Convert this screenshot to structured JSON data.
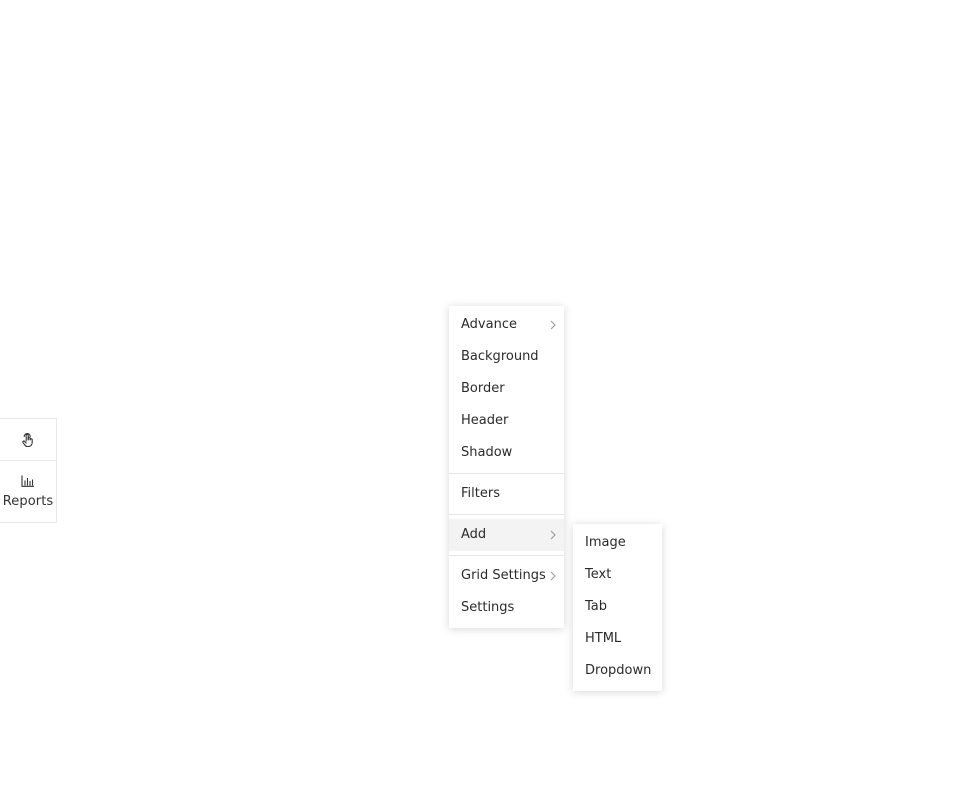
{
  "toolbar": {
    "interact_icon": "hand-pointer-icon",
    "reports_icon": "bar-chart-icon",
    "reports_label": "Reports"
  },
  "context_menu": {
    "group1": [
      {
        "label": "Advance",
        "has_submenu": true
      },
      {
        "label": "Background"
      },
      {
        "label": "Border"
      },
      {
        "label": "Header"
      },
      {
        "label": "Shadow"
      }
    ],
    "group2": [
      {
        "label": "Filters"
      }
    ],
    "group3": [
      {
        "label": "Add",
        "has_submenu": true,
        "active": true
      }
    ],
    "group4": [
      {
        "label": "Grid Settings",
        "has_submenu": true
      },
      {
        "label": "Settings"
      }
    ]
  },
  "add_submenu": {
    "items": [
      {
        "label": "Image"
      },
      {
        "label": "Text"
      },
      {
        "label": "Tab"
      },
      {
        "label": "HTML"
      },
      {
        "label": "Dropdown"
      }
    ]
  },
  "colors": {
    "text": "#2b2b2b",
    "active_bg": "#f3f3f3",
    "divider": "#e6e6e6",
    "chevron": "#9a9a9a"
  }
}
